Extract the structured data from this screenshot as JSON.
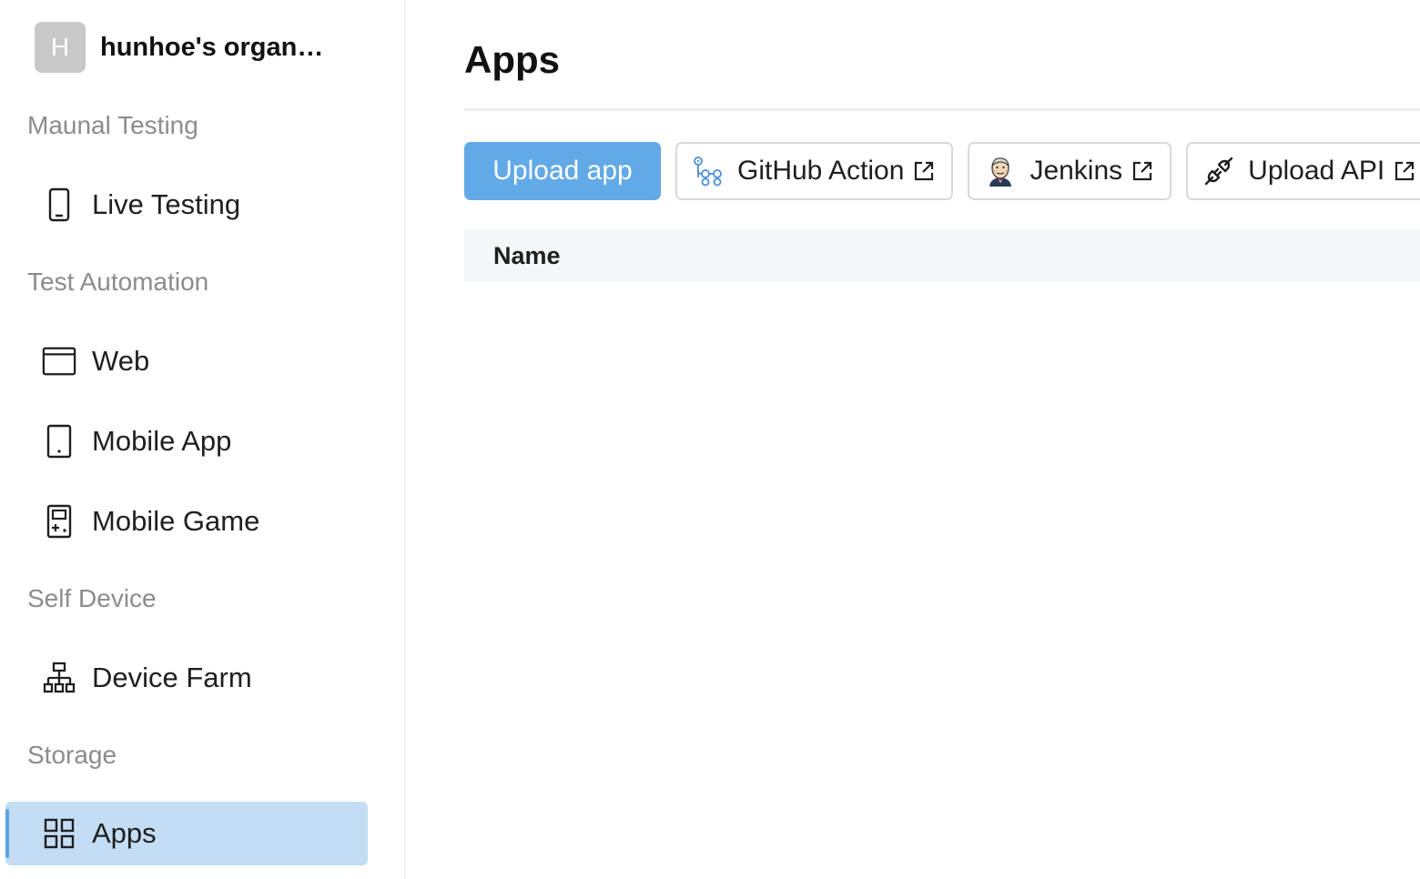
{
  "org": {
    "avatar_letter": "H",
    "name": "hunhoe's organization"
  },
  "sidebar": {
    "sections": [
      {
        "title": "Maunal Testing",
        "items": [
          {
            "label": "Live Testing",
            "icon": "phone-icon"
          }
        ]
      },
      {
        "title": "Test Automation",
        "items": [
          {
            "label": "Web",
            "icon": "browser-window-icon"
          },
          {
            "label": "Mobile App",
            "icon": "mobile-device-icon"
          },
          {
            "label": "Mobile Game",
            "icon": "gamepad-icon"
          }
        ]
      },
      {
        "title": "Self Device",
        "items": [
          {
            "label": "Device Farm",
            "icon": "network-tree-icon"
          }
        ]
      },
      {
        "title": "Storage",
        "items": [
          {
            "label": "Apps",
            "icon": "grid-icon",
            "active": true
          }
        ]
      }
    ]
  },
  "main": {
    "title": "Apps",
    "toolbar": {
      "upload_app": "Upload app",
      "github_action": "GitHub Action",
      "jenkins": "Jenkins",
      "upload_api": "Upload API"
    },
    "table": {
      "columns": [
        "Name"
      ]
    }
  },
  "colors": {
    "primary": "#62a9e8",
    "active_bg": "#c3ddf5",
    "muted_text": "#8c8c8c",
    "table_header_bg": "#f5f6f7"
  }
}
